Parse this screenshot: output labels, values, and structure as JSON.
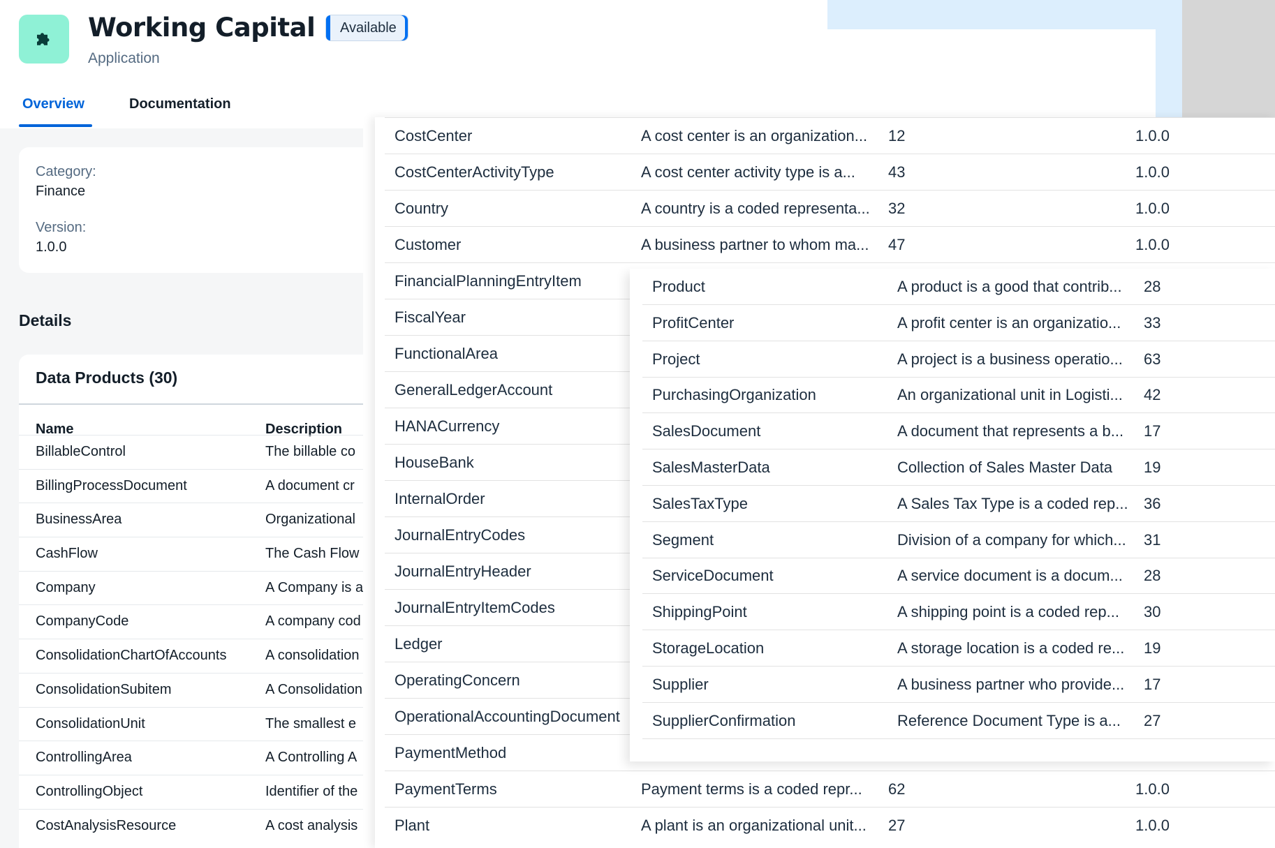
{
  "header": {
    "title": "Working Capital",
    "subtitle": "Application",
    "status": "Available",
    "icon": "puzzle-icon",
    "icon_color": "#8ff1d6"
  },
  "tabs": [
    {
      "label": "Overview",
      "active": true
    },
    {
      "label": "Documentation",
      "active": false
    }
  ],
  "info": {
    "category_label": "Category:",
    "category_value": "Finance",
    "version_label": "Version:",
    "version_value": "1.0.0"
  },
  "details": {
    "title": "Details",
    "data_products_title": "Data Products (30)",
    "col_name": "Name",
    "col_description": "Description",
    "rows": [
      {
        "name": "BillableControl",
        "description": "The billable co"
      },
      {
        "name": "BillingProcessDocument",
        "description": "A document cr"
      },
      {
        "name": "BusinessArea",
        "description": "Organizational"
      },
      {
        "name": "CashFlow",
        "description": "The Cash Flow"
      },
      {
        "name": "Company",
        "description": "A Company is a"
      },
      {
        "name": "CompanyCode",
        "description": "A company cod"
      },
      {
        "name": "ConsolidationChartOfAccounts",
        "description": "A consolidation"
      },
      {
        "name": "ConsolidationSubitem",
        "description": "A Consolidation"
      },
      {
        "name": "ConsolidationUnit",
        "description": "The smallest e"
      },
      {
        "name": "ControllingArea",
        "description": "A Controlling A"
      },
      {
        "name": "ControllingObject",
        "description": "Identifier of the"
      },
      {
        "name": "CostAnalysisResource",
        "description": "A cost analysis"
      }
    ]
  },
  "overlay1": {
    "rows": [
      {
        "name": "CostCenter",
        "description": "A cost center is an organization...",
        "count": "12",
        "version": "1.0.0"
      },
      {
        "name": "CostCenterActivityType",
        "description": "A cost center activity type is a...",
        "count": "43",
        "version": "1.0.0"
      },
      {
        "name": "Country",
        "description": "A country is a coded representa...",
        "count": "32",
        "version": "1.0.0"
      },
      {
        "name": "Customer",
        "description": "A business partner to whom ma...",
        "count": "47",
        "version": "1.0.0"
      },
      {
        "name": "FinancialPlanningEntryItem",
        "description": "",
        "count": "",
        "version": ""
      },
      {
        "name": "FiscalYear",
        "description": "",
        "count": "",
        "version": ""
      },
      {
        "name": "FunctionalArea",
        "description": "",
        "count": "",
        "version": ""
      },
      {
        "name": "GeneralLedgerAccount",
        "description": "",
        "count": "",
        "version": ""
      },
      {
        "name": "HANACurrency",
        "description": "",
        "count": "",
        "version": ""
      },
      {
        "name": "HouseBank",
        "description": "",
        "count": "",
        "version": ""
      },
      {
        "name": "InternalOrder",
        "description": "",
        "count": "",
        "version": ""
      },
      {
        "name": "JournalEntryCodes",
        "description": "",
        "count": "",
        "version": ""
      },
      {
        "name": "JournalEntryHeader",
        "description": "",
        "count": "",
        "version": ""
      },
      {
        "name": "JournalEntryItemCodes",
        "description": "",
        "count": "",
        "version": ""
      },
      {
        "name": "Ledger",
        "description": "",
        "count": "",
        "version": ""
      },
      {
        "name": "OperatingConcern",
        "description": "",
        "count": "",
        "version": ""
      },
      {
        "name": "OperationalAccountingDocument",
        "description": "",
        "count": "",
        "version": ""
      },
      {
        "name": "PaymentMethod",
        "description": "",
        "count": "",
        "version": ""
      },
      {
        "name": "PaymentTerms",
        "description": "Payment terms is a coded repr...",
        "count": "62",
        "version": "1.0.0"
      },
      {
        "name": "Plant",
        "description": "A plant is an organizational unit...",
        "count": "27",
        "version": "1.0.0"
      }
    ]
  },
  "overlay2": {
    "rows": [
      {
        "name": "Product",
        "description": "A product is a good that contrib...",
        "count": "28"
      },
      {
        "name": "ProfitCenter",
        "description": "A profit center is an organizatio...",
        "count": "33"
      },
      {
        "name": "Project",
        "description": "A project is a business operatio...",
        "count": "63"
      },
      {
        "name": "PurchasingOrganization",
        "description": "An organizational unit in Logisti...",
        "count": "42"
      },
      {
        "name": "SalesDocument",
        "description": "A document that represents a b...",
        "count": "17"
      },
      {
        "name": "SalesMasterData",
        "description": "Collection of Sales Master Data",
        "count": "19"
      },
      {
        "name": "SalesTaxType",
        "description": "A Sales Tax Type is a coded rep...",
        "count": "36"
      },
      {
        "name": "Segment",
        "description": "Division of a company for which...",
        "count": "31"
      },
      {
        "name": "ServiceDocument",
        "description": "A service document is a docum...",
        "count": "28"
      },
      {
        "name": "ShippingPoint",
        "description": "A shipping point is a coded rep...",
        "count": "30"
      },
      {
        "name": "StorageLocation",
        "description": "A storage location is a coded re...",
        "count": "19"
      },
      {
        "name": "Supplier",
        "description": "A business partner who provide...",
        "count": "17"
      },
      {
        "name": "SupplierConfirmation",
        "description": "Reference Document Type is a...",
        "count": "27"
      }
    ]
  }
}
